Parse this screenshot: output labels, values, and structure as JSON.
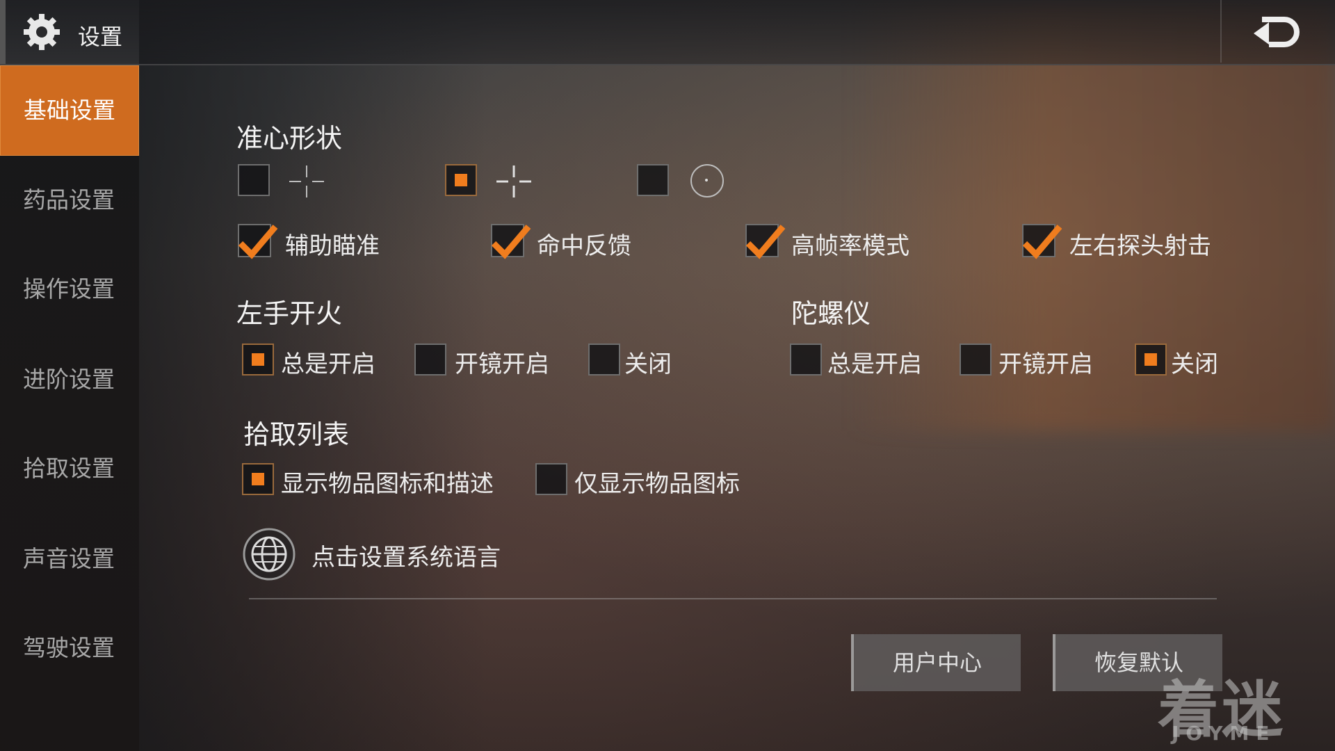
{
  "window": {
    "title": "设置"
  },
  "sidebar": {
    "items": [
      {
        "label": "基础设置",
        "active": true
      },
      {
        "label": "药品设置",
        "active": false
      },
      {
        "label": "操作设置",
        "active": false
      },
      {
        "label": "进阶设置",
        "active": false
      },
      {
        "label": "拾取设置",
        "active": false
      },
      {
        "label": "声音设置",
        "active": false
      },
      {
        "label": "驾驶设置",
        "active": false
      }
    ]
  },
  "crosshair": {
    "heading": "准心形状",
    "options": [
      {
        "style": "crosshair-thin",
        "selected": false
      },
      {
        "style": "crosshair-thick",
        "selected": true
      },
      {
        "style": "circle-dot",
        "selected": false
      }
    ]
  },
  "toggles": [
    {
      "label": "辅助瞄准",
      "checked": true
    },
    {
      "label": "命中反馈",
      "checked": true
    },
    {
      "label": "高帧率模式",
      "checked": true
    },
    {
      "label": "左右探头射击",
      "checked": true
    }
  ],
  "left_fire": {
    "heading": "左手开火",
    "options": [
      {
        "label": "总是开启",
        "selected": true
      },
      {
        "label": "开镜开启",
        "selected": false
      },
      {
        "label": "关闭",
        "selected": false
      }
    ]
  },
  "gyroscope": {
    "heading": "陀螺仪",
    "options": [
      {
        "label": "总是开启",
        "selected": false
      },
      {
        "label": "开镜开启",
        "selected": false
      },
      {
        "label": "关闭",
        "selected": true
      }
    ]
  },
  "pickup_list": {
    "heading": "拾取列表",
    "options": [
      {
        "label": "显示物品图标和描述",
        "selected": true
      },
      {
        "label": "仅显示物品图标",
        "selected": false
      }
    ]
  },
  "language": {
    "label": "点击设置系统语言",
    "icon": "globe-icon"
  },
  "buttons": {
    "user_center": "用户中心",
    "restore_default": "恢复默认"
  },
  "watermark": {
    "text": "着迷",
    "sub": "JOYME"
  },
  "colors": {
    "accent": "#cf6b1f",
    "selected_fill": "#f07d1e"
  }
}
